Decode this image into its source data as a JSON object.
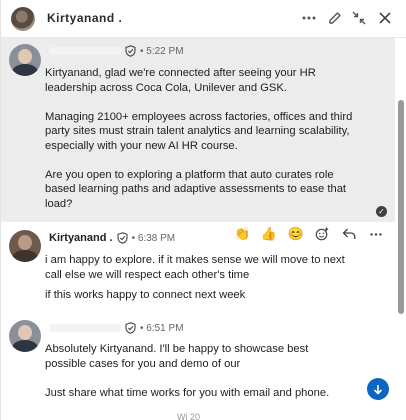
{
  "header": {
    "name": "Kirtyanand .",
    "icons": [
      "more-icon",
      "compose-icon",
      "collapse-icon",
      "close-icon"
    ]
  },
  "messages": [
    {
      "sender": "",
      "time": "• 5:22 PM",
      "paragraphs": [
        "Kirtyanand, glad we're connected after seeing your HR leadership across Coca Cola, Unilever and GSK.",
        "Managing 2100+ employees across factories, offices and third party sites must strain talent analytics and learning scalability, especially with your new AI HR course.",
        "Are you open to exploring a platform that auto curates role based learning paths and adaptive assessments to ease that load?"
      ]
    },
    {
      "sender": "Kirtyanand .",
      "time": "• 6:38 PM",
      "paragraphs": [
        "i am happy to explore. if it makes sense we will move to next call else we will respect each other's time",
        "if this works happy to connect next week"
      ]
    },
    {
      "sender": "",
      "time": "• 6:51 PM",
      "paragraphs": [
        "Absolutely Kirtyanand. I'll be happy to showcase best possible cases for you and demo of our",
        "Just share what time works for you with email and phone."
      ]
    }
  ],
  "reactions": [
    "👏",
    "👍",
    "😊",
    "react-add-icon",
    "reply-icon",
    "more-icon"
  ],
  "footer_peek": "Wi 20"
}
